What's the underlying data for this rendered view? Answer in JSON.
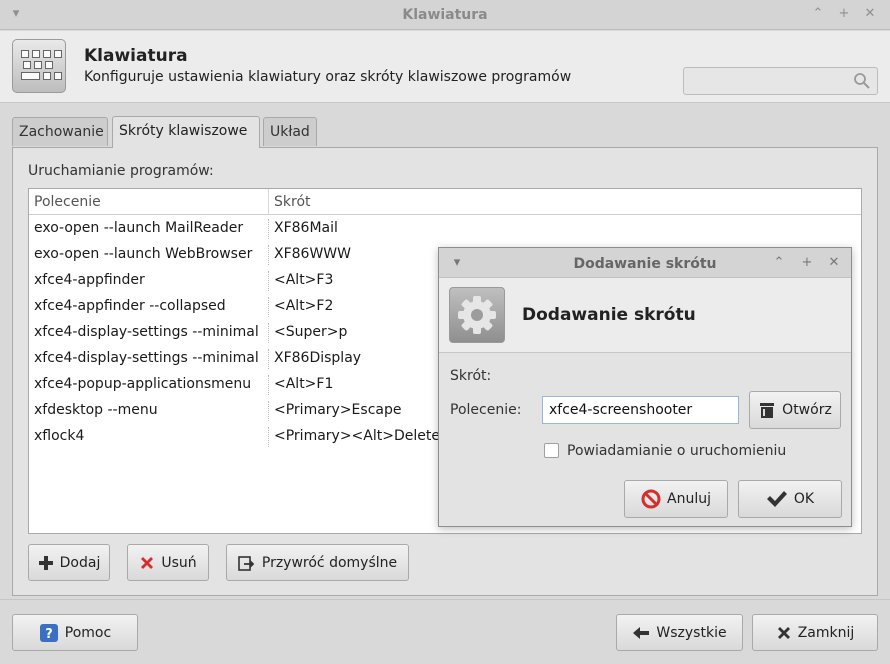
{
  "window": {
    "title": "Klawiatura"
  },
  "header": {
    "title": "Klawiatura",
    "subtitle": "Konfiguruje ustawienia klawiatury oraz skróty klawiszowe programów",
    "search_placeholder": ""
  },
  "tabs": [
    {
      "label": "Zachowanie",
      "active": false
    },
    {
      "label": "Skróty klawiszowe",
      "active": true
    },
    {
      "label": "Układ",
      "active": false
    }
  ],
  "section_label": "Uruchamianie programów:",
  "table": {
    "columns": [
      "Polecenie",
      "Skrót"
    ],
    "rows": [
      [
        "exo-open --launch MailReader",
        "XF86Mail"
      ],
      [
        "exo-open --launch WebBrowser",
        "XF86WWW"
      ],
      [
        "xfce4-appfinder",
        "<Alt>F3"
      ],
      [
        "xfce4-appfinder --collapsed",
        "<Alt>F2"
      ],
      [
        "xfce4-display-settings --minimal",
        "<Super>p"
      ],
      [
        "xfce4-display-settings --minimal",
        "XF86Display"
      ],
      [
        "xfce4-popup-applicationsmenu",
        "<Alt>F1"
      ],
      [
        "xfdesktop --menu",
        "<Primary>Escape"
      ],
      [
        "xflock4",
        "<Primary><Alt>Delete"
      ]
    ]
  },
  "panel_buttons": {
    "add": "Dodaj",
    "remove": "Usuń",
    "restore": "Przywróć domyślne"
  },
  "footer": {
    "help": "Pomoc",
    "all": "Wszystkie",
    "close": "Zamknij"
  },
  "dialog": {
    "title": "Dodawanie skrótu",
    "heading": "Dodawanie skrótu",
    "shortcut_label": "Skrót:",
    "command_label": "Polecenie:",
    "command_value": "xfce4-screenshooter",
    "open_button": "Otwórz",
    "notify_label": "Powiadamianie o uruchomieniu",
    "notify_checked": false,
    "cancel_button": "Anuluj",
    "ok_button": "OK"
  },
  "colors": {
    "cancel_icon": "#d42f2f",
    "remove_icon": "#d42f2f",
    "help_icon": "#3a6fc4"
  }
}
